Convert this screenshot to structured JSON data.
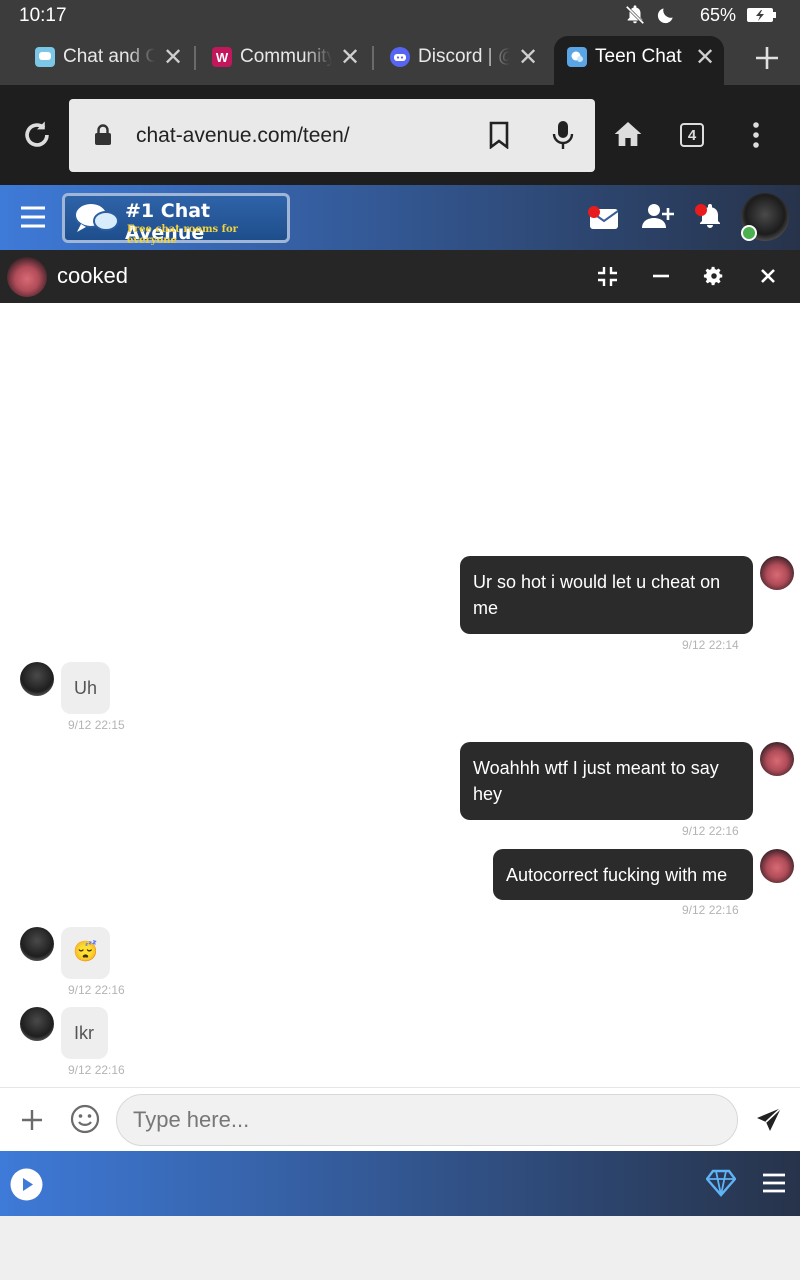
{
  "status": {
    "time": "10:17",
    "battery": "65%"
  },
  "tabs": [
    {
      "title": "Chat and C",
      "favicon": "chat-and-chat-favicon",
      "color": "#6bb6e8"
    },
    {
      "title": "Community",
      "favicon": "w-favicon",
      "color": "#c2185b",
      "letter": "W"
    },
    {
      "title": "Discord | @",
      "favicon": "discord-favicon",
      "color": "#5865f2"
    },
    {
      "title": "Teen Chat",
      "favicon": "chat-avenue-favicon",
      "color": "#3d8fd6"
    }
  ],
  "browser": {
    "url": "chat-avenue.com/teen/",
    "tab_count": "4"
  },
  "site": {
    "logo_title": "#1 Chat Avenue",
    "logo_subtitle": "Free chat rooms for everyone"
  },
  "chat": {
    "partner_name": "cooked",
    "messages": [
      {
        "from": "me",
        "lines": [
          "Ur so hot i would let u cheat on",
          "me"
        ],
        "time": "9/12 22:14"
      },
      {
        "from": "them",
        "text": "Uh",
        "time": "9/12 22:15"
      },
      {
        "from": "me",
        "lines": [
          "Woahhh wtf I just meant to say",
          "hey"
        ],
        "time": "9/12 22:16"
      },
      {
        "from": "me",
        "text": "Autocorrect fucking with me",
        "time": "9/12 22:16"
      },
      {
        "from": "them",
        "text": "😴",
        "time": "9/12 22:16"
      },
      {
        "from": "them",
        "text": "Ikr",
        "time": "9/12 22:16"
      }
    ],
    "input_placeholder": "Type here..."
  },
  "colors": {
    "header_gradient_start": "#3e7ad8",
    "header_gradient_end": "#27334a",
    "online": "#4caf50"
  }
}
